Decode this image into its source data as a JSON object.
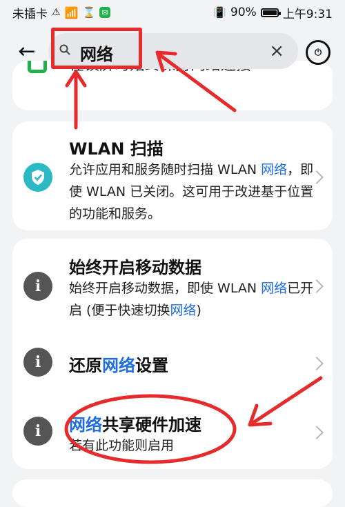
{
  "statusbar": {
    "carrier": "未插卡",
    "battery_pct": "90%",
    "time": "上午9:31",
    "battery_level": 0.9
  },
  "search": {
    "query": "网络"
  },
  "clipped_item": {
    "text": "在锁屏时始终保持网络连接"
  },
  "items": [
    {
      "title": "WLAN 扫描",
      "desc_parts": [
        "允许应用和服务随时扫描 WLAN ",
        "网络",
        "，即使 WLAN 已关闭。这可用于改进基于位置的功能和服务。"
      ]
    },
    {
      "title": "始终开启移动数据",
      "desc_parts": [
        "始终开启移动数据，即使 WLAN ",
        "网络",
        "已开启 (便于快速切换",
        "网络",
        ")"
      ]
    },
    {
      "title_parts": [
        "还原",
        "网络",
        "设置"
      ]
    },
    {
      "title_parts": [
        "网络",
        "共享硬件加速"
      ],
      "desc": "若有此功能则启用"
    }
  ],
  "colors": {
    "highlight": "#1f6ee0",
    "annotation": "#e52b2b",
    "shield": "#2bb9c4",
    "info": "#555555"
  },
  "icons": [
    "back-arrow-icon",
    "search-icon",
    "clear-icon",
    "power-icon",
    "shield-check-icon",
    "info-icon",
    "chevron-right-icon"
  ]
}
